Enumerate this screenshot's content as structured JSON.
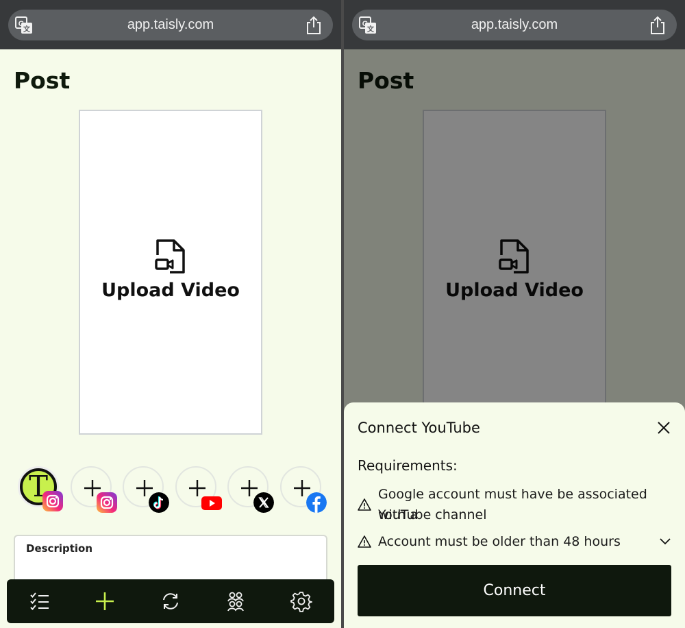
{
  "browser": {
    "url": "app.taisly.com"
  },
  "page": {
    "title": "Post",
    "upload_label": "Upload Video",
    "description_label": "Description"
  },
  "accounts": [
    {
      "type": "avatar",
      "avatar_letter": "T",
      "platform": "instagram"
    },
    {
      "type": "add",
      "platform": "instagram"
    },
    {
      "type": "add",
      "platform": "tiktok"
    },
    {
      "type": "add",
      "platform": "youtube"
    },
    {
      "type": "add",
      "platform": "x"
    },
    {
      "type": "add",
      "platform": "facebook"
    }
  ],
  "tabs": [
    "checklist-icon",
    "plus-icon",
    "refresh-icon",
    "group-icon",
    "gear-icon"
  ],
  "sheet": {
    "title": "Connect YouTube",
    "requirements_heading": "Requirements:",
    "requirement_1_line1": "Google account must have be associated with a",
    "requirement_1_line2": "YouTube channel",
    "requirement_2": "Account must be older than 48 hours",
    "connect_label": "Connect"
  },
  "colors": {
    "accent": "#c8f04d",
    "dark": "#0f180d",
    "background": "#f6fbea"
  }
}
